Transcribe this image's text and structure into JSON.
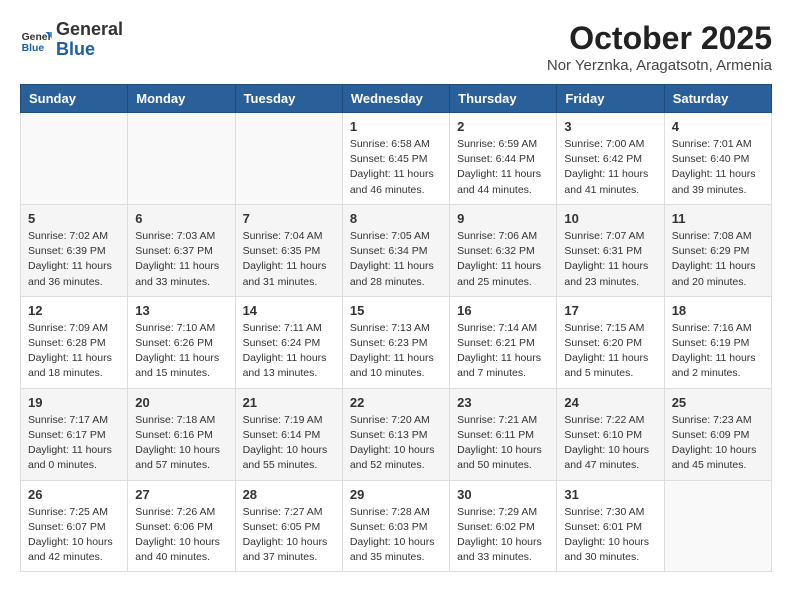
{
  "logo": {
    "general": "General",
    "blue": "Blue"
  },
  "title": "October 2025",
  "location": "Nor Yerznka, Aragatsotn, Armenia",
  "weekdays": [
    "Sunday",
    "Monday",
    "Tuesday",
    "Wednesday",
    "Thursday",
    "Friday",
    "Saturday"
  ],
  "weeks": [
    [
      {
        "day": "",
        "info": ""
      },
      {
        "day": "",
        "info": ""
      },
      {
        "day": "",
        "info": ""
      },
      {
        "day": "1",
        "info": "Sunrise: 6:58 AM\nSunset: 6:45 PM\nDaylight: 11 hours\nand 46 minutes."
      },
      {
        "day": "2",
        "info": "Sunrise: 6:59 AM\nSunset: 6:44 PM\nDaylight: 11 hours\nand 44 minutes."
      },
      {
        "day": "3",
        "info": "Sunrise: 7:00 AM\nSunset: 6:42 PM\nDaylight: 11 hours\nand 41 minutes."
      },
      {
        "day": "4",
        "info": "Sunrise: 7:01 AM\nSunset: 6:40 PM\nDaylight: 11 hours\nand 39 minutes."
      }
    ],
    [
      {
        "day": "5",
        "info": "Sunrise: 7:02 AM\nSunset: 6:39 PM\nDaylight: 11 hours\nand 36 minutes."
      },
      {
        "day": "6",
        "info": "Sunrise: 7:03 AM\nSunset: 6:37 PM\nDaylight: 11 hours\nand 33 minutes."
      },
      {
        "day": "7",
        "info": "Sunrise: 7:04 AM\nSunset: 6:35 PM\nDaylight: 11 hours\nand 31 minutes."
      },
      {
        "day": "8",
        "info": "Sunrise: 7:05 AM\nSunset: 6:34 PM\nDaylight: 11 hours\nand 28 minutes."
      },
      {
        "day": "9",
        "info": "Sunrise: 7:06 AM\nSunset: 6:32 PM\nDaylight: 11 hours\nand 25 minutes."
      },
      {
        "day": "10",
        "info": "Sunrise: 7:07 AM\nSunset: 6:31 PM\nDaylight: 11 hours\nand 23 minutes."
      },
      {
        "day": "11",
        "info": "Sunrise: 7:08 AM\nSunset: 6:29 PM\nDaylight: 11 hours\nand 20 minutes."
      }
    ],
    [
      {
        "day": "12",
        "info": "Sunrise: 7:09 AM\nSunset: 6:28 PM\nDaylight: 11 hours\nand 18 minutes."
      },
      {
        "day": "13",
        "info": "Sunrise: 7:10 AM\nSunset: 6:26 PM\nDaylight: 11 hours\nand 15 minutes."
      },
      {
        "day": "14",
        "info": "Sunrise: 7:11 AM\nSunset: 6:24 PM\nDaylight: 11 hours\nand 13 minutes."
      },
      {
        "day": "15",
        "info": "Sunrise: 7:13 AM\nSunset: 6:23 PM\nDaylight: 11 hours\nand 10 minutes."
      },
      {
        "day": "16",
        "info": "Sunrise: 7:14 AM\nSunset: 6:21 PM\nDaylight: 11 hours\nand 7 minutes."
      },
      {
        "day": "17",
        "info": "Sunrise: 7:15 AM\nSunset: 6:20 PM\nDaylight: 11 hours\nand 5 minutes."
      },
      {
        "day": "18",
        "info": "Sunrise: 7:16 AM\nSunset: 6:19 PM\nDaylight: 11 hours\nand 2 minutes."
      }
    ],
    [
      {
        "day": "19",
        "info": "Sunrise: 7:17 AM\nSunset: 6:17 PM\nDaylight: 11 hours\nand 0 minutes."
      },
      {
        "day": "20",
        "info": "Sunrise: 7:18 AM\nSunset: 6:16 PM\nDaylight: 10 hours\nand 57 minutes."
      },
      {
        "day": "21",
        "info": "Sunrise: 7:19 AM\nSunset: 6:14 PM\nDaylight: 10 hours\nand 55 minutes."
      },
      {
        "day": "22",
        "info": "Sunrise: 7:20 AM\nSunset: 6:13 PM\nDaylight: 10 hours\nand 52 minutes."
      },
      {
        "day": "23",
        "info": "Sunrise: 7:21 AM\nSunset: 6:11 PM\nDaylight: 10 hours\nand 50 minutes."
      },
      {
        "day": "24",
        "info": "Sunrise: 7:22 AM\nSunset: 6:10 PM\nDaylight: 10 hours\nand 47 minutes."
      },
      {
        "day": "25",
        "info": "Sunrise: 7:23 AM\nSunset: 6:09 PM\nDaylight: 10 hours\nand 45 minutes."
      }
    ],
    [
      {
        "day": "26",
        "info": "Sunrise: 7:25 AM\nSunset: 6:07 PM\nDaylight: 10 hours\nand 42 minutes."
      },
      {
        "day": "27",
        "info": "Sunrise: 7:26 AM\nSunset: 6:06 PM\nDaylight: 10 hours\nand 40 minutes."
      },
      {
        "day": "28",
        "info": "Sunrise: 7:27 AM\nSunset: 6:05 PM\nDaylight: 10 hours\nand 37 minutes."
      },
      {
        "day": "29",
        "info": "Sunrise: 7:28 AM\nSunset: 6:03 PM\nDaylight: 10 hours\nand 35 minutes."
      },
      {
        "day": "30",
        "info": "Sunrise: 7:29 AM\nSunset: 6:02 PM\nDaylight: 10 hours\nand 33 minutes."
      },
      {
        "day": "31",
        "info": "Sunrise: 7:30 AM\nSunset: 6:01 PM\nDaylight: 10 hours\nand 30 minutes."
      },
      {
        "day": "",
        "info": ""
      }
    ]
  ]
}
